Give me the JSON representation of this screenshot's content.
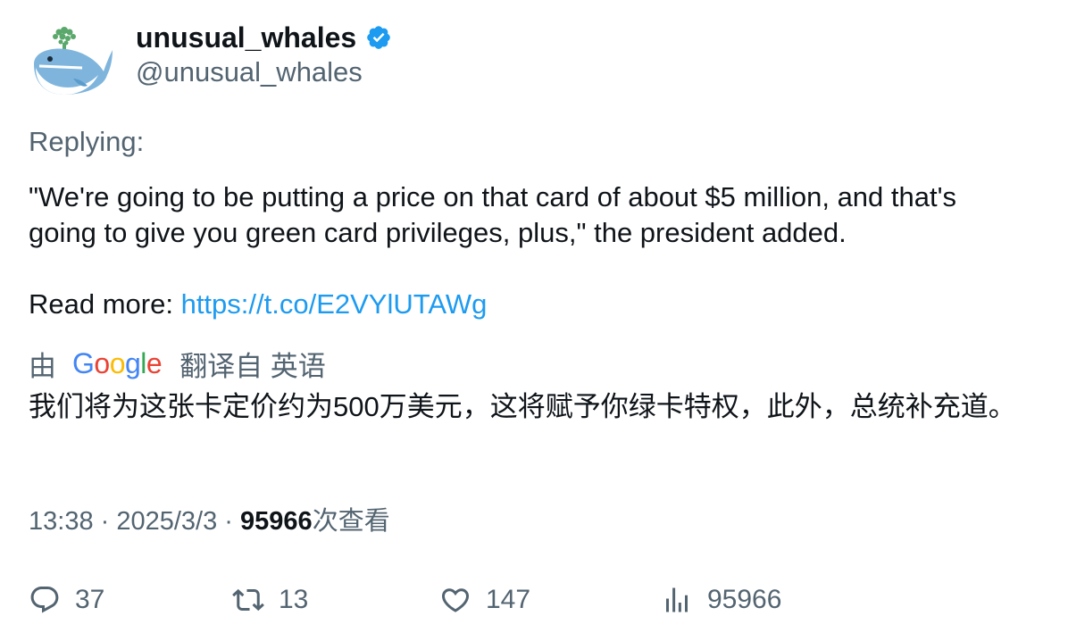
{
  "author": {
    "display_name": "unusual_whales",
    "handle": "@unusual_whales",
    "avatar_icon": "whale-icon",
    "verified_icon": "verified-badge-icon"
  },
  "replying_label": "Replying:",
  "tweet": {
    "text": "\"We're going to be putting a price on that card of about $5 million, and that's going to give you green card privileges, plus,\" the president added.",
    "read_more_label": "Read more: ",
    "link": "https://t.co/E2VYlUTAWg"
  },
  "translation": {
    "prefix": "由",
    "provider": "Google",
    "suffix": "翻译自 英语",
    "text": "我们将为这张卡定价约为500万美元，这将赋予你绿卡特权，此外，总统补充道。"
  },
  "meta": {
    "time": "13:38",
    "separator": " · ",
    "date": "2025/3/3",
    "views": "95966",
    "views_label": "次查看"
  },
  "actions": {
    "replies": "37",
    "retweets": "13",
    "likes": "147",
    "views": "95966"
  },
  "colors": {
    "link": "#1d9bf0",
    "muted": "#536471",
    "text": "#0f1419",
    "verified": "#1d9bf0"
  }
}
